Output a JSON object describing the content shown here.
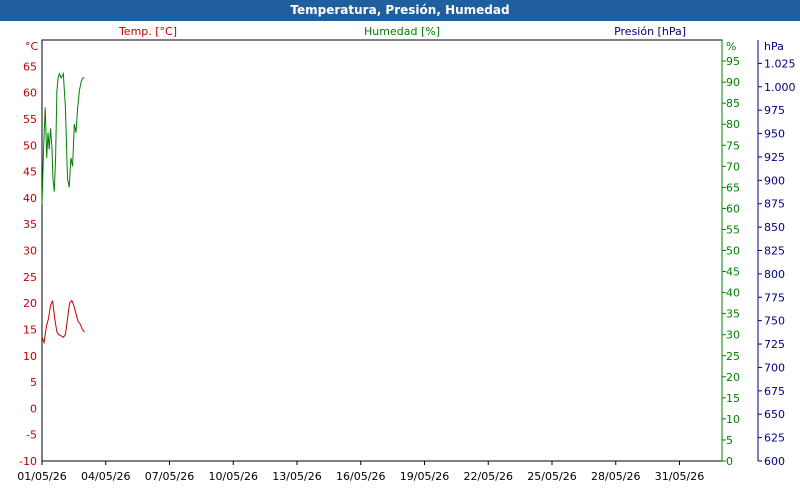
{
  "window": {
    "title": "Temperatura, Presión, Humedad"
  },
  "chart_data": {
    "type": "line",
    "title": "Temperatura, Presión, Humedad",
    "grid": true,
    "x": {
      "ticks": [
        "01/05/26",
        "04/05/26",
        "07/05/26",
        "10/05/26",
        "13/05/26",
        "16/05/26",
        "19/05/26",
        "22/05/26",
        "25/05/26",
        "28/05/26",
        "31/05/26"
      ],
      "range_days": [
        0,
        32
      ]
    },
    "axes": {
      "temperature": {
        "label": "Temp. [°C]",
        "unit": "°C",
        "range": [
          -10,
          70
        ],
        "ticks": [
          -10,
          -5,
          0,
          5,
          10,
          15,
          20,
          25,
          30,
          35,
          40,
          45,
          50,
          55,
          60,
          65
        ],
        "color": "#c00000"
      },
      "humidity": {
        "label": "Humedad [%]",
        "unit": "%",
        "range": [
          0,
          100
        ],
        "ticks": [
          0,
          5,
          10,
          15,
          20,
          25,
          30,
          35,
          40,
          45,
          50,
          55,
          60,
          65,
          70,
          75,
          80,
          85,
          90,
          95
        ],
        "color": "#008000"
      },
      "pressure": {
        "label": "Presión [hPa]",
        "unit": "hPa",
        "range": [
          600,
          1050
        ],
        "ticks": [
          "600",
          "625",
          "650",
          "675",
          "700",
          "725",
          "750",
          "775",
          "800",
          "825",
          "850",
          "875",
          "900",
          "925",
          "950",
          "975",
          "1.000",
          "1.025"
        ],
        "color": "#000080"
      }
    },
    "series": [
      {
        "axis": "temperature",
        "color": "#c00000",
        "x": [
          0.0,
          0.1,
          0.2,
          0.3,
          0.4,
          0.5,
          0.6,
          0.7,
          0.8,
          0.9,
          1.0,
          1.1,
          1.2,
          1.3,
          1.4,
          1.5,
          1.6,
          1.7,
          1.8,
          1.9,
          2.0
        ],
        "y": [
          13.5,
          12.5,
          15.5,
          17.0,
          19.5,
          20.5,
          17.0,
          14.5,
          14.0,
          13.8,
          13.5,
          14.0,
          17.0,
          20.0,
          20.5,
          19.5,
          18.0,
          16.5,
          16.0,
          15.0,
          14.5
        ]
      },
      {
        "axis": "humidity",
        "color": "#008000",
        "x": [
          0.0,
          0.08,
          0.15,
          0.22,
          0.28,
          0.34,
          0.4,
          0.46,
          0.52,
          0.58,
          0.64,
          0.7,
          0.76,
          0.82,
          0.9,
          1.0,
          1.1,
          1.2,
          1.28,
          1.36,
          1.44,
          1.52,
          1.6,
          1.68,
          1.76,
          1.84,
          1.92,
          2.0
        ],
        "y": [
          61,
          75,
          84,
          72,
          78,
          74,
          79,
          75,
          67,
          64,
          72,
          88,
          91,
          92,
          91,
          92,
          84,
          67,
          65,
          72,
          70,
          80,
          78,
          84,
          88,
          90,
          91,
          91
        ]
      }
    ]
  }
}
